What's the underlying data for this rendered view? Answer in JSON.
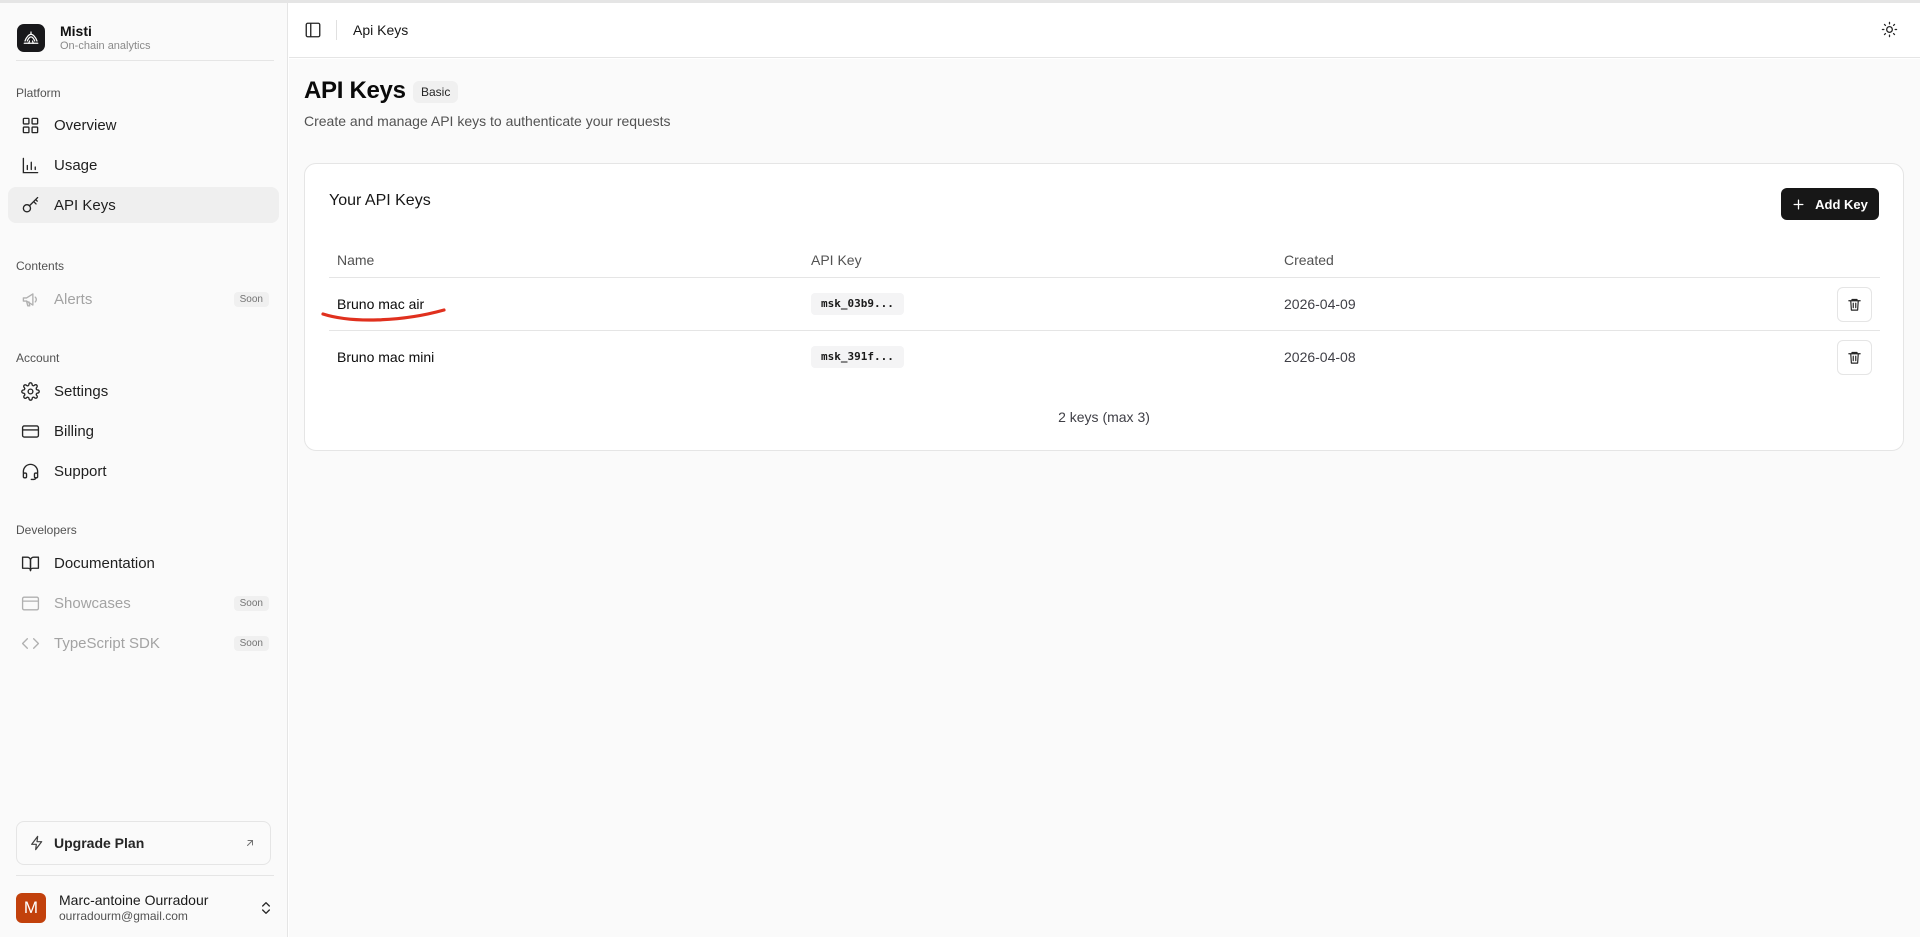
{
  "brand": {
    "name": "Misti",
    "tagline": "On-chain analytics"
  },
  "sidebar": {
    "groups": [
      {
        "label": "Platform",
        "items": [
          {
            "label": "Overview",
            "icon": "grid-icon"
          },
          {
            "label": "Usage",
            "icon": "bar-chart-icon"
          },
          {
            "label": "API Keys",
            "icon": "key-icon",
            "active": true
          }
        ]
      },
      {
        "label": "Contents",
        "items": [
          {
            "label": "Alerts",
            "icon": "megaphone-icon",
            "badge": "Soon",
            "disabled": true
          }
        ]
      },
      {
        "label": "Account",
        "items": [
          {
            "label": "Settings",
            "icon": "gear-icon"
          },
          {
            "label": "Billing",
            "icon": "credit-card-icon"
          },
          {
            "label": "Support",
            "icon": "headset-icon"
          }
        ]
      },
      {
        "label": "Developers",
        "items": [
          {
            "label": "Documentation",
            "icon": "book-icon"
          },
          {
            "label": "Showcases",
            "icon": "browser-window-icon",
            "badge": "Soon",
            "disabled": true
          },
          {
            "label": "TypeScript SDK",
            "icon": "code-icon",
            "badge": "Soon",
            "disabled": true
          }
        ]
      }
    ],
    "upgrade_label": "Upgrade Plan",
    "user": {
      "initial": "M",
      "name": "Marc-antoine Ourradour",
      "email": "ourradourm@gmail.com"
    }
  },
  "header": {
    "title": "Api Keys"
  },
  "page": {
    "title": "API Keys",
    "plan_badge": "Basic",
    "description": "Create and manage API keys to authenticate your requests"
  },
  "card": {
    "title": "Your API Keys",
    "add_button": "Add Key",
    "columns": [
      "Name",
      "API Key",
      "Created"
    ],
    "rows": [
      {
        "name": "Bruno mac air",
        "key": "msk_03b9...",
        "created": "2026-04-09"
      },
      {
        "name": "Bruno mac mini",
        "key": "msk_391f...",
        "created": "2026-04-08"
      }
    ],
    "footer": "2 keys (max 3)"
  },
  "colors": {
    "accent_dark": "#171717",
    "avatar": "#c2410c",
    "annotation_stroke": "#e0301e",
    "sidebar_bg": "#fafafa"
  }
}
